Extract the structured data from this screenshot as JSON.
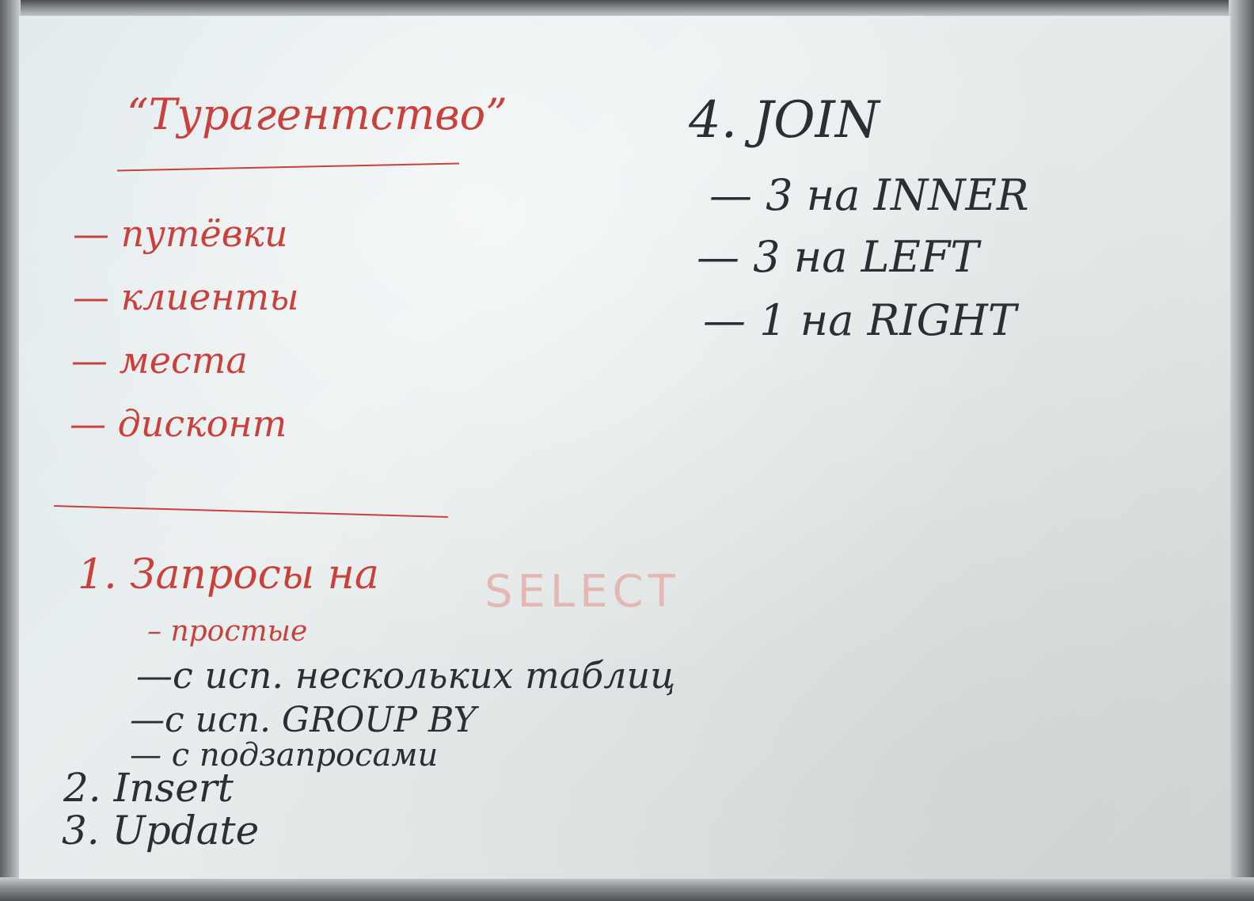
{
  "whiteboard": {
    "top_left": {
      "heading": "“Турагентство”",
      "items": [
        "— путёвки",
        "— клиенты",
        "— места",
        "— дисконт"
      ]
    },
    "tasks": {
      "item1": "1. Запросы на",
      "item1_keyword": "SELECT",
      "item1_sub": [
        "– простые",
        "—с исп. нескольких таблиц",
        "—с исп. GROUP BY",
        "— с подзапросами"
      ],
      "item2": "2. Insert",
      "item3": "3. Update"
    },
    "join_block": {
      "title": "4. JOIN",
      "lines": [
        "— 3 на INNER",
        "— 3 на LEFT",
        "— 1 на RIGHT"
      ]
    }
  },
  "colors": {
    "red_marker": "#c9413b",
    "black_marker": "#2b2e33",
    "board_surface": "#e4ecec"
  }
}
